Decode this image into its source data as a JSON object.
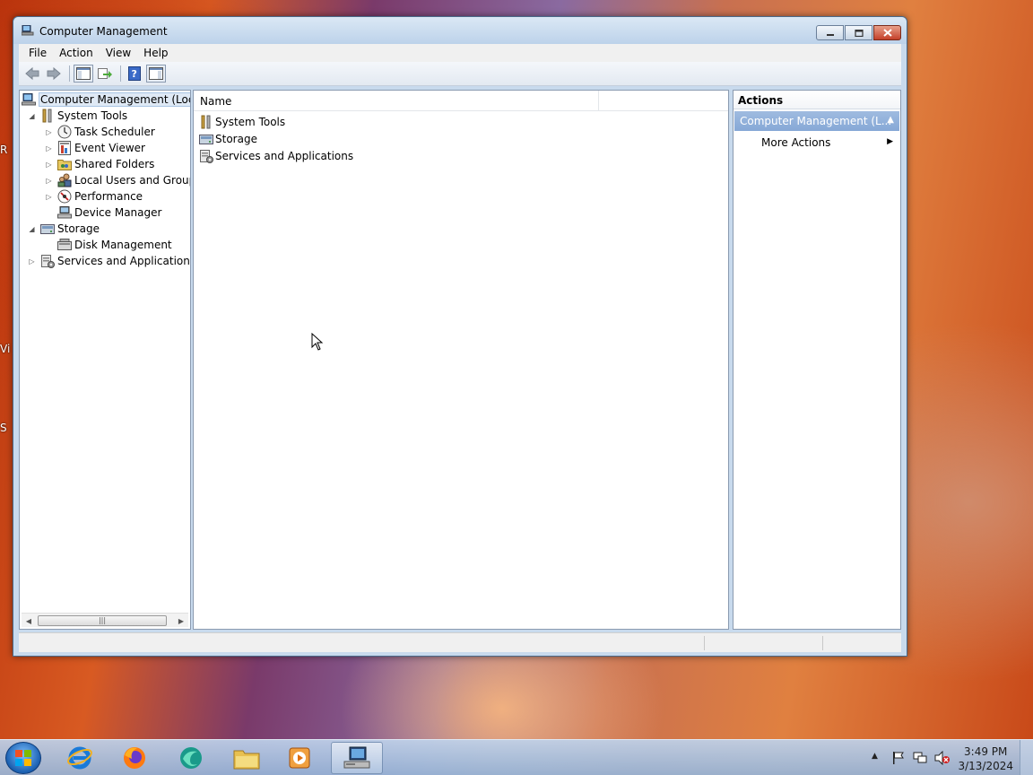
{
  "window": {
    "title": "Computer Management"
  },
  "menu": [
    "File",
    "Action",
    "View",
    "Help"
  ],
  "tree": {
    "root": "Computer Management (Local",
    "items": [
      {
        "label": "System Tools",
        "level": 1,
        "expander": "expanded"
      },
      {
        "label": "Task Scheduler",
        "level": 2,
        "expander": "collapsed"
      },
      {
        "label": "Event Viewer",
        "level": 2,
        "expander": "collapsed"
      },
      {
        "label": "Shared Folders",
        "level": 2,
        "expander": "collapsed"
      },
      {
        "label": "Local Users and Groups",
        "level": 2,
        "expander": "collapsed"
      },
      {
        "label": "Performance",
        "level": 2,
        "expander": "collapsed"
      },
      {
        "label": "Device Manager",
        "level": 2,
        "expander": "none"
      },
      {
        "label": "Storage",
        "level": 1,
        "expander": "expanded"
      },
      {
        "label": "Disk Management",
        "level": 2,
        "expander": "none"
      },
      {
        "label": "Services and Applications",
        "level": 1,
        "expander": "collapsed"
      }
    ]
  },
  "list": {
    "column_header": "Name",
    "rows": [
      "System Tools",
      "Storage",
      "Services and Applications"
    ]
  },
  "actions": {
    "title": "Actions",
    "section": "Computer Management (L...",
    "item": "More Actions"
  },
  "taskbar": {
    "time": "3:49 PM",
    "date": "3/13/2024"
  },
  "desktop_edge": [
    "R",
    "Vi",
    "S"
  ]
}
